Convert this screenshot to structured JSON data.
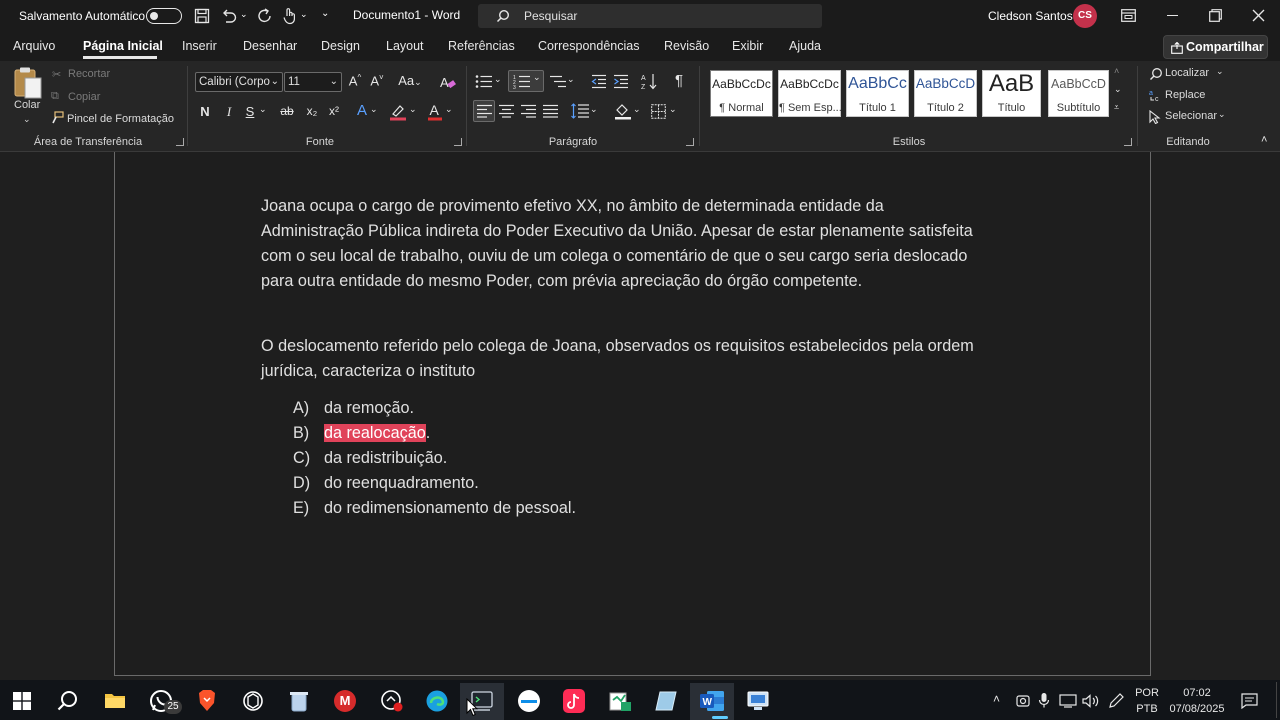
{
  "titlebar": {
    "autosave_label": "Salvamento Automático",
    "document_title": "Documento1 - Word",
    "search_placeholder": "Pesquisar",
    "user_name": "Cledson Santos",
    "user_initials": "CS"
  },
  "tabs": [
    {
      "label": "Arquivo"
    },
    {
      "label": "Página Inicial",
      "active": true
    },
    {
      "label": "Inserir"
    },
    {
      "label": "Desenhar"
    },
    {
      "label": "Design"
    },
    {
      "label": "Layout"
    },
    {
      "label": "Referências"
    },
    {
      "label": "Correspondências"
    },
    {
      "label": "Revisão"
    },
    {
      "label": "Exibir"
    },
    {
      "label": "Ajuda"
    }
  ],
  "share_label": "Compartilhar",
  "clipboard": {
    "paste_label": "Colar",
    "cut_label": "Recortar",
    "copy_label": "Copiar",
    "format_painter_label": "Pincel de Formatação",
    "group_title": "Área de Transferência"
  },
  "font": {
    "font_name": "Calibri (Corpo",
    "font_size": "11",
    "bold": "N",
    "italic": "I",
    "underline": "S",
    "strike": "ab",
    "subscript": "x₂",
    "superscript": "x²",
    "grow": "A^",
    "shrink": "A˅",
    "case": "Aa",
    "group_title": "Fonte"
  },
  "paragraph": {
    "group_title": "Parágrafo",
    "pilcrow": "¶"
  },
  "styles": {
    "group_title": "Estilos",
    "items": [
      {
        "sample": "AaBbCcDc",
        "name": "¶ Normal"
      },
      {
        "sample": "AaBbCcDc",
        "name": "¶ Sem Esp..."
      },
      {
        "sample": "AaBbCc",
        "name": "Título 1"
      },
      {
        "sample": "AaBbCcD",
        "name": "Título 2"
      },
      {
        "sample": "AaB",
        "name": "Título"
      },
      {
        "sample": "AaBbCcD",
        "name": "Subtítulo"
      }
    ]
  },
  "editing": {
    "find_label": "Localizar",
    "replace_label": "Replace",
    "select_label": "Selecionar",
    "group_title": "Editando"
  },
  "document": {
    "paragraph1": "Joana ocupa o cargo de provimento efetivo XX, no âmbito de determinada entidade da Administração Pública indireta do Poder Executivo da União. Apesar de estar plenamente satisfeita com o seu local de trabalho, ouviu de um colega o comentário de que o seu cargo seria deslocado para outra entidade do mesmo Poder, com prévia apreciação do órgão competente.",
    "paragraph2": "O deslocamento referido pelo colega de Joana, observados os requisitos estabelecidos pela ordem jurídica, caracteriza o instituto",
    "options": [
      {
        "letter": "A)",
        "text": "da remoção."
      },
      {
        "letter": "B)",
        "text": "da realocação",
        "suffix": ".",
        "highlighted": true
      },
      {
        "letter": "C)",
        "text": "da redistribuição."
      },
      {
        "letter": "D)",
        "text": "do reenquadramento."
      },
      {
        "letter": "E)",
        "text": "do redimensionamento de pessoal."
      }
    ]
  },
  "taskbar": {
    "whatsapp_badge": "25",
    "lang_line1": "POR",
    "lang_line2": "PTB",
    "time": "07:02",
    "date": "07/08/2025"
  },
  "colors": {
    "accent_avatar": "#c4314b",
    "highlight": "#e0435a",
    "word_blue": "#185abd"
  }
}
